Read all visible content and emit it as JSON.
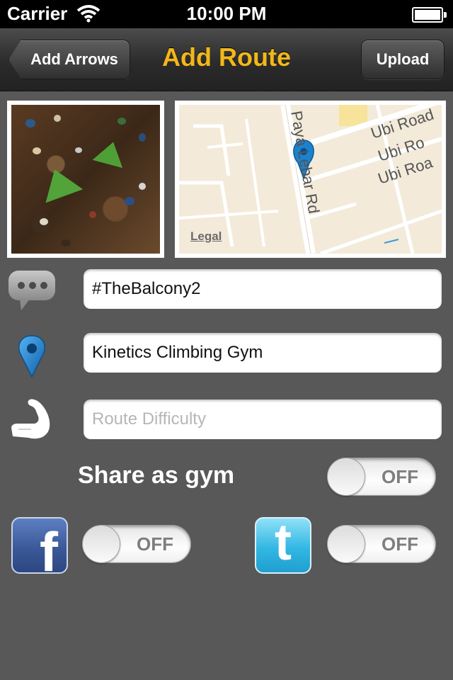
{
  "status_bar": {
    "carrier": "Carrier",
    "time": "10:00 PM"
  },
  "nav": {
    "back_label": "Add Arrows",
    "title": "Add Route",
    "right_label": "Upload"
  },
  "map": {
    "roads": [
      "Paya Lebar Rd",
      "Ubi Road",
      "Ubi Ro",
      "Ubi Roa"
    ],
    "legal_label": "Legal"
  },
  "form": {
    "name_value": "#TheBalcony2",
    "location_value": "Kinetics Climbing Gym",
    "difficulty_placeholder": "Route Difficulty"
  },
  "share": {
    "gym_label": "Share as gym",
    "gym_state": "OFF",
    "facebook_state": "OFF",
    "twitter_state": "OFF",
    "facebook_glyph": "f",
    "twitter_glyph": "t"
  },
  "icons": {
    "comment": "speech-bubble-icon",
    "location": "map-pin-icon",
    "difficulty": "flexed-arm-icon",
    "facebook": "facebook-icon",
    "twitter": "twitter-icon"
  },
  "colors": {
    "title": "#f2b71a",
    "background": "#585858",
    "facebook": "#3b5998",
    "twitter": "#33b7e3"
  }
}
